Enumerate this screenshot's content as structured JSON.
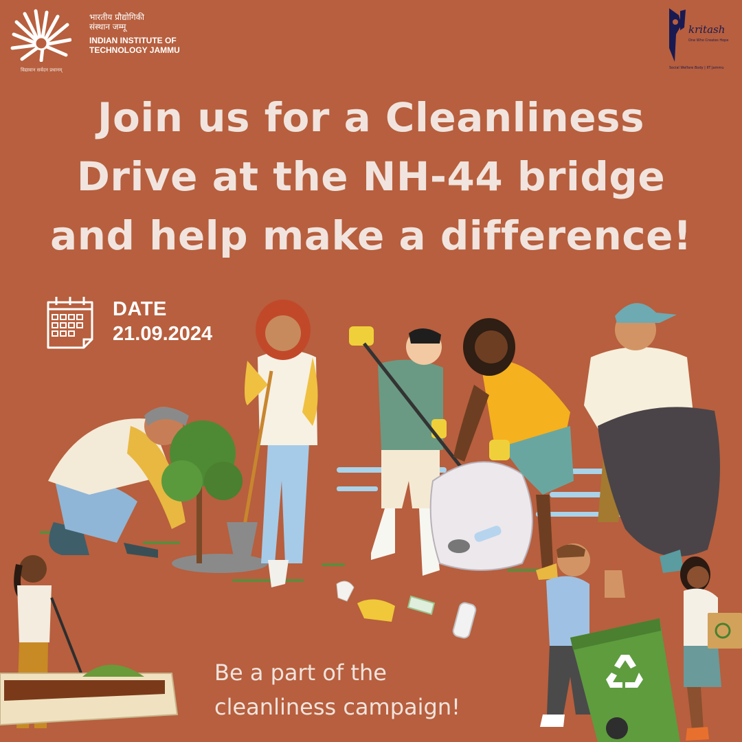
{
  "header": {
    "institute_hindi_line1": "भारतीय प्रौद्योगिकी",
    "institute_hindi_line2": "संस्थान जम्मू",
    "institute_name_line1": "INDIAN INSTITUTE OF",
    "institute_name_line2": "TECHNOLOGY JAMMU",
    "institute_motto": "विद्यावान सर्वदन प्रधानम्",
    "club_name": "kritash",
    "club_tagline": "One Who Creates Hope",
    "club_footer": "Social Welfare Body | IIT Jammu"
  },
  "headline": {
    "line1": "Join us for a Cleanliness",
    "line2": "Drive at the NH-44 bridge",
    "line3": "and help make a difference!"
  },
  "event": {
    "date_label": "DATE",
    "date_value": "21.09.2024"
  },
  "cta": {
    "line1": "Be a part of the",
    "line2": "cleanliness campaign!"
  },
  "colors": {
    "background": "#b75f3e",
    "headline_text": "#f1e4de",
    "accent_white": "#ffffff",
    "club_logo": "#1a1a52"
  },
  "icons": [
    "iit-jammu-logo-icon",
    "kritash-logo-icon",
    "calendar-icon",
    "recycle-icon"
  ]
}
